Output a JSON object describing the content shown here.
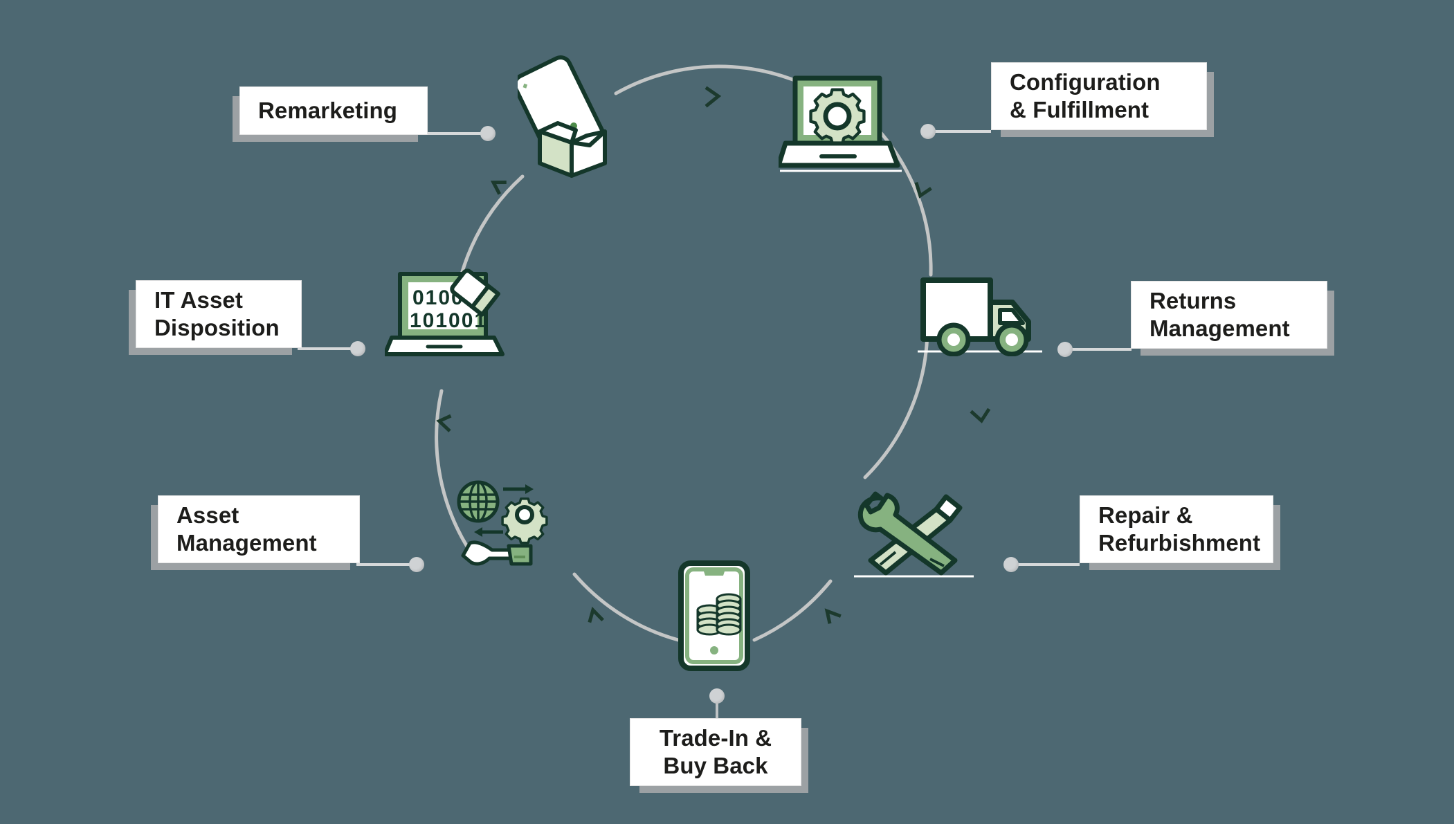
{
  "background_color": "#4d6872",
  "diagram": {
    "type": "circular-lifecycle",
    "nodes": [
      {
        "id": "configuration-fulfillment",
        "label": "Configuration\n& Fulfillment",
        "icon": "laptop-gear-icon",
        "position": "top-right",
        "label_side": "right"
      },
      {
        "id": "returns-management",
        "label": "Returns\nManagement",
        "icon": "delivery-truck-icon",
        "position": "right",
        "label_side": "right"
      },
      {
        "id": "repair-refurbishment",
        "label": "Repair &\nRefurbishment",
        "icon": "wrench-screwdriver-icon",
        "position": "bottom-right",
        "label_side": "right"
      },
      {
        "id": "trade-in-buy-back",
        "label": "Trade-In &\nBuy Back",
        "icon": "phone-coins-icon",
        "position": "bottom",
        "label_side": "bottom"
      },
      {
        "id": "asset-management",
        "label": "Asset\nManagement",
        "icon": "globe-gear-hand-icon",
        "position": "bottom-left",
        "label_side": "left"
      },
      {
        "id": "it-asset-disposition",
        "label": "IT Asset\nDisposition",
        "icon": "laptop-binary-erase-icon",
        "position": "left",
        "label_side": "left"
      },
      {
        "id": "remarketing",
        "label": "Remarketing",
        "icon": "phone-in-box-icon",
        "position": "top-left",
        "label_side": "left"
      }
    ],
    "flow_direction": "clockwise",
    "arc_color": "#c4c6c6",
    "arrow_color": "#1c3a2d",
    "connector_dot_color": "#cfd2d4",
    "card_background": "#ffffff",
    "card_text_color": "#1d1d1b",
    "card_shadow_color": "#a0a4a6",
    "palette": {
      "dark_green": "#14372a",
      "mid_green": "#86b280",
      "light_green": "#d3e2c6",
      "white": "#ffffff"
    },
    "icon_details": {
      "laptop_binary_line1": "0100",
      "laptop_binary_line2": "101001"
    }
  }
}
